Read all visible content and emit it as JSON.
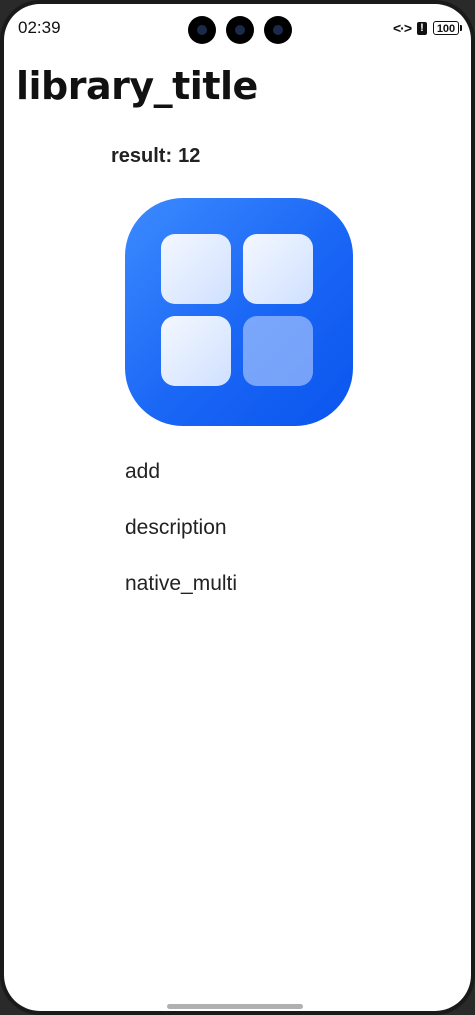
{
  "status_bar": {
    "time": "02:39",
    "battery": "100",
    "alert_glyph": "!",
    "code_glyph": "<·>"
  },
  "page": {
    "title": "library_title"
  },
  "result": {
    "label": "result:",
    "value": "12"
  },
  "app_icon": {
    "name": "app-grid-icon",
    "color": "#1a66f5"
  },
  "menu": {
    "items": [
      {
        "label": "add"
      },
      {
        "label": "description"
      },
      {
        "label": "native_multi"
      }
    ]
  }
}
